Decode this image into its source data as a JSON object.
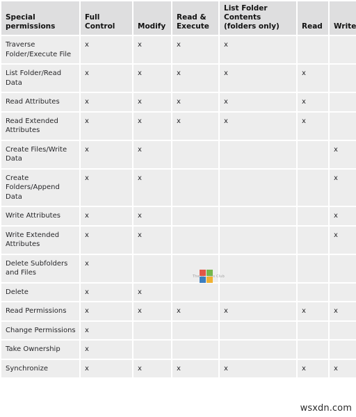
{
  "table": {
    "columns": [
      {
        "key": "name",
        "label": "Special permissions"
      },
      {
        "key": "full",
        "label": "Full Control"
      },
      {
        "key": "mod",
        "label": "Modify"
      },
      {
        "key": "rx",
        "label": "Read & Execute"
      },
      {
        "key": "lfc",
        "label": "List Folder Contents (folders only)"
      },
      {
        "key": "read",
        "label": "Read"
      },
      {
        "key": "write",
        "label": "Write"
      }
    ],
    "mark": "x",
    "rows": [
      {
        "name": "Traverse Folder/Execute File",
        "marks": [
          "x",
          "x",
          "x",
          "x",
          "",
          ""
        ]
      },
      {
        "name": "List Folder/Read Data",
        "marks": [
          "x",
          "x",
          "x",
          "x",
          "x",
          ""
        ]
      },
      {
        "name": "Read Attributes",
        "marks": [
          "x",
          "x",
          "x",
          "x",
          "x",
          ""
        ]
      },
      {
        "name": "Read Extended Attributes",
        "marks": [
          "x",
          "x",
          "x",
          "x",
          "x",
          ""
        ]
      },
      {
        "name": "Create Files/Write Data",
        "marks": [
          "x",
          "x",
          "",
          "",
          "",
          "x"
        ]
      },
      {
        "name": "Create Folders/Append Data",
        "marks": [
          "x",
          "x",
          "",
          "",
          "",
          "x"
        ]
      },
      {
        "name": "Write Attributes",
        "marks": [
          "x",
          "x",
          "",
          "",
          "",
          "x"
        ]
      },
      {
        "name": "Write Extended Attributes",
        "marks": [
          "x",
          "x",
          "",
          "",
          "",
          "x"
        ]
      },
      {
        "name": "Delete Subfolders and Files",
        "marks": [
          "x",
          "",
          "",
          "",
          "",
          ""
        ]
      },
      {
        "name": "Delete",
        "marks": [
          "x",
          "x",
          "",
          "",
          "",
          ""
        ]
      },
      {
        "name": "Read Permissions",
        "marks": [
          "x",
          "x",
          "x",
          "x",
          "x",
          "x"
        ]
      },
      {
        "name": "Change Permissions",
        "marks": [
          "x",
          "",
          "",
          "",
          "",
          ""
        ]
      },
      {
        "name": "Take Ownership",
        "marks": [
          "x",
          "",
          "",
          "",
          "",
          ""
        ]
      },
      {
        "name": "Synchronize",
        "marks": [
          "x",
          "x",
          "x",
          "x",
          "x",
          "x"
        ]
      }
    ]
  },
  "watermarks": {
    "windows_club": {
      "text_pre": "The W",
      "text_post": "ows Club"
    },
    "site": "wsxdn.com"
  },
  "colors": {
    "header_bg": "#dededf",
    "cell_bg": "#ededed",
    "page_bg": "#ffffff",
    "text": "#27272a",
    "logo_red": "#e04b3a",
    "logo_green": "#6cb33f",
    "logo_blue": "#2f76bc",
    "logo_yellow": "#f0ac22"
  }
}
